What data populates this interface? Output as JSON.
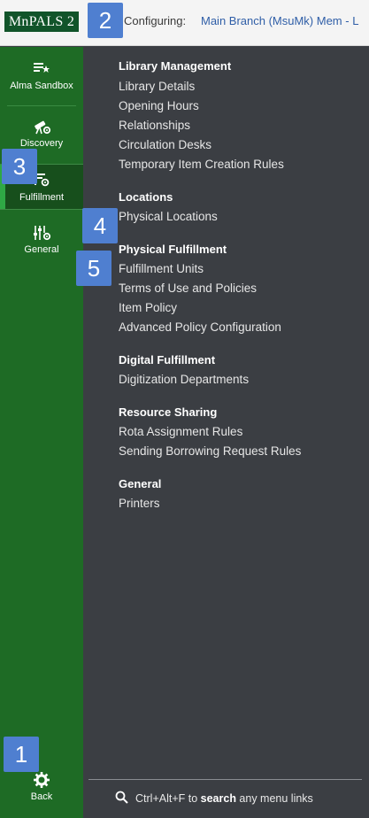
{
  "header": {
    "logo_text": "MnPALS 2",
    "configuring_label": "Configuring:",
    "configuring_value": "Main Branch (MsuMk) Mem - L"
  },
  "sidebar": {
    "items": [
      {
        "label": "Alma Sandbox",
        "icon": "list-star-icon"
      },
      {
        "label": "Discovery",
        "icon": "telescope-gear-icon"
      },
      {
        "label": "Fulfillment",
        "icon": "fulfillment-gear-icon",
        "active": true
      },
      {
        "label": "General",
        "icon": "sliders-gear-icon"
      }
    ],
    "back_label": "Back",
    "back_icon": "gear-icon"
  },
  "menu": {
    "sections": [
      {
        "title": "Library Management",
        "links": [
          "Library Details",
          "Opening Hours",
          "Relationships",
          "Circulation Desks",
          "Temporary Item Creation Rules"
        ]
      },
      {
        "title": "Locations",
        "links": [
          "Physical Locations"
        ]
      },
      {
        "title": "Physical Fulfillment",
        "links": [
          "Fulfillment Units",
          "Terms of Use and Policies",
          "Item Policy",
          "Advanced Policy Configuration"
        ]
      },
      {
        "title": "Digital Fulfillment",
        "links": [
          "Digitization Departments"
        ]
      },
      {
        "title": "Resource Sharing",
        "links": [
          "Rota Assignment Rules",
          "Sending Borrowing Request Rules"
        ]
      },
      {
        "title": "General",
        "links": [
          "Printers"
        ]
      }
    ]
  },
  "footer": {
    "shortcut": "Ctrl+Alt+F",
    "to": " to ",
    "search_word": "search",
    "rest": " any menu links"
  },
  "badges": [
    "1",
    "2",
    "3",
    "4",
    "5"
  ],
  "colors": {
    "sidebar": "#1e6b25",
    "panel": "#3b3e43",
    "badge": "#4f7fd0",
    "link": "#2f5ea7"
  }
}
